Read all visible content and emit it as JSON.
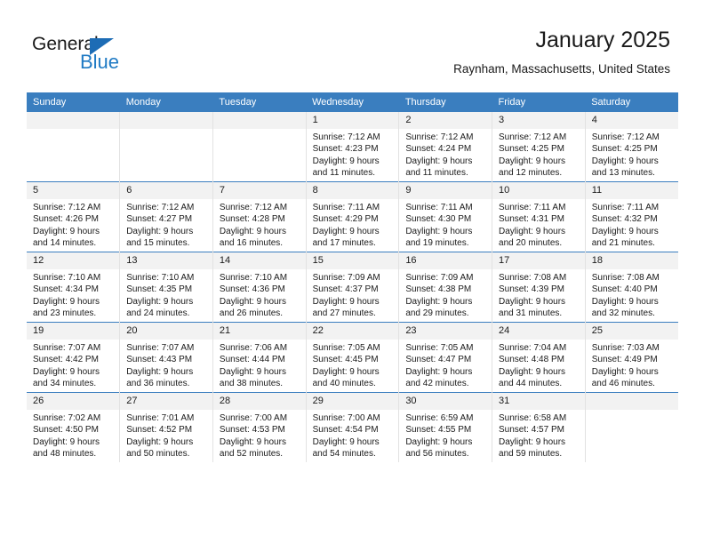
{
  "brand": {
    "name_part1": "General",
    "name_part2": "Blue",
    "logo_color": "#1f7ac4"
  },
  "header": {
    "title": "January 2025",
    "subtitle": "Raynham, Massachusetts, United States"
  },
  "calendar": {
    "header_bg": "#3a7ebf",
    "daynum_bg": "#f2f2f2",
    "weekday_headers": [
      "Sunday",
      "Monday",
      "Tuesday",
      "Wednesday",
      "Thursday",
      "Friday",
      "Saturday"
    ],
    "labels": {
      "sunrise_prefix": "Sunrise:",
      "sunset_prefix": "Sunset:",
      "daylight_prefix": "Daylight:"
    },
    "weeks": [
      [
        {
          "day": "",
          "empty": true
        },
        {
          "day": "",
          "empty": true
        },
        {
          "day": "",
          "empty": true
        },
        {
          "day": "1",
          "sunrise": "Sunrise: 7:12 AM",
          "sunset": "Sunset: 4:23 PM",
          "daylight_line1": "Daylight: 9 hours",
          "daylight_line2": "and 11 minutes."
        },
        {
          "day": "2",
          "sunrise": "Sunrise: 7:12 AM",
          "sunset": "Sunset: 4:24 PM",
          "daylight_line1": "Daylight: 9 hours",
          "daylight_line2": "and 11 minutes."
        },
        {
          "day": "3",
          "sunrise": "Sunrise: 7:12 AM",
          "sunset": "Sunset: 4:25 PM",
          "daylight_line1": "Daylight: 9 hours",
          "daylight_line2": "and 12 minutes."
        },
        {
          "day": "4",
          "sunrise": "Sunrise: 7:12 AM",
          "sunset": "Sunset: 4:25 PM",
          "daylight_line1": "Daylight: 9 hours",
          "daylight_line2": "and 13 minutes."
        }
      ],
      [
        {
          "day": "5",
          "sunrise": "Sunrise: 7:12 AM",
          "sunset": "Sunset: 4:26 PM",
          "daylight_line1": "Daylight: 9 hours",
          "daylight_line2": "and 14 minutes."
        },
        {
          "day": "6",
          "sunrise": "Sunrise: 7:12 AM",
          "sunset": "Sunset: 4:27 PM",
          "daylight_line1": "Daylight: 9 hours",
          "daylight_line2": "and 15 minutes."
        },
        {
          "day": "7",
          "sunrise": "Sunrise: 7:12 AM",
          "sunset": "Sunset: 4:28 PM",
          "daylight_line1": "Daylight: 9 hours",
          "daylight_line2": "and 16 minutes."
        },
        {
          "day": "8",
          "sunrise": "Sunrise: 7:11 AM",
          "sunset": "Sunset: 4:29 PM",
          "daylight_line1": "Daylight: 9 hours",
          "daylight_line2": "and 17 minutes."
        },
        {
          "day": "9",
          "sunrise": "Sunrise: 7:11 AM",
          "sunset": "Sunset: 4:30 PM",
          "daylight_line1": "Daylight: 9 hours",
          "daylight_line2": "and 19 minutes."
        },
        {
          "day": "10",
          "sunrise": "Sunrise: 7:11 AM",
          "sunset": "Sunset: 4:31 PM",
          "daylight_line1": "Daylight: 9 hours",
          "daylight_line2": "and 20 minutes."
        },
        {
          "day": "11",
          "sunrise": "Sunrise: 7:11 AM",
          "sunset": "Sunset: 4:32 PM",
          "daylight_line1": "Daylight: 9 hours",
          "daylight_line2": "and 21 minutes."
        }
      ],
      [
        {
          "day": "12",
          "sunrise": "Sunrise: 7:10 AM",
          "sunset": "Sunset: 4:34 PM",
          "daylight_line1": "Daylight: 9 hours",
          "daylight_line2": "and 23 minutes."
        },
        {
          "day": "13",
          "sunrise": "Sunrise: 7:10 AM",
          "sunset": "Sunset: 4:35 PM",
          "daylight_line1": "Daylight: 9 hours",
          "daylight_line2": "and 24 minutes."
        },
        {
          "day": "14",
          "sunrise": "Sunrise: 7:10 AM",
          "sunset": "Sunset: 4:36 PM",
          "daylight_line1": "Daylight: 9 hours",
          "daylight_line2": "and 26 minutes."
        },
        {
          "day": "15",
          "sunrise": "Sunrise: 7:09 AM",
          "sunset": "Sunset: 4:37 PM",
          "daylight_line1": "Daylight: 9 hours",
          "daylight_line2": "and 27 minutes."
        },
        {
          "day": "16",
          "sunrise": "Sunrise: 7:09 AM",
          "sunset": "Sunset: 4:38 PM",
          "daylight_line1": "Daylight: 9 hours",
          "daylight_line2": "and 29 minutes."
        },
        {
          "day": "17",
          "sunrise": "Sunrise: 7:08 AM",
          "sunset": "Sunset: 4:39 PM",
          "daylight_line1": "Daylight: 9 hours",
          "daylight_line2": "and 31 minutes."
        },
        {
          "day": "18",
          "sunrise": "Sunrise: 7:08 AM",
          "sunset": "Sunset: 4:40 PM",
          "daylight_line1": "Daylight: 9 hours",
          "daylight_line2": "and 32 minutes."
        }
      ],
      [
        {
          "day": "19",
          "sunrise": "Sunrise: 7:07 AM",
          "sunset": "Sunset: 4:42 PM",
          "daylight_line1": "Daylight: 9 hours",
          "daylight_line2": "and 34 minutes."
        },
        {
          "day": "20",
          "sunrise": "Sunrise: 7:07 AM",
          "sunset": "Sunset: 4:43 PM",
          "daylight_line1": "Daylight: 9 hours",
          "daylight_line2": "and 36 minutes."
        },
        {
          "day": "21",
          "sunrise": "Sunrise: 7:06 AM",
          "sunset": "Sunset: 4:44 PM",
          "daylight_line1": "Daylight: 9 hours",
          "daylight_line2": "and 38 minutes."
        },
        {
          "day": "22",
          "sunrise": "Sunrise: 7:05 AM",
          "sunset": "Sunset: 4:45 PM",
          "daylight_line1": "Daylight: 9 hours",
          "daylight_line2": "and 40 minutes."
        },
        {
          "day": "23",
          "sunrise": "Sunrise: 7:05 AM",
          "sunset": "Sunset: 4:47 PM",
          "daylight_line1": "Daylight: 9 hours",
          "daylight_line2": "and 42 minutes."
        },
        {
          "day": "24",
          "sunrise": "Sunrise: 7:04 AM",
          "sunset": "Sunset: 4:48 PM",
          "daylight_line1": "Daylight: 9 hours",
          "daylight_line2": "and 44 minutes."
        },
        {
          "day": "25",
          "sunrise": "Sunrise: 7:03 AM",
          "sunset": "Sunset: 4:49 PM",
          "daylight_line1": "Daylight: 9 hours",
          "daylight_line2": "and 46 minutes."
        }
      ],
      [
        {
          "day": "26",
          "sunrise": "Sunrise: 7:02 AM",
          "sunset": "Sunset: 4:50 PM",
          "daylight_line1": "Daylight: 9 hours",
          "daylight_line2": "and 48 minutes."
        },
        {
          "day": "27",
          "sunrise": "Sunrise: 7:01 AM",
          "sunset": "Sunset: 4:52 PM",
          "daylight_line1": "Daylight: 9 hours",
          "daylight_line2": "and 50 minutes."
        },
        {
          "day": "28",
          "sunrise": "Sunrise: 7:00 AM",
          "sunset": "Sunset: 4:53 PM",
          "daylight_line1": "Daylight: 9 hours",
          "daylight_line2": "and 52 minutes."
        },
        {
          "day": "29",
          "sunrise": "Sunrise: 7:00 AM",
          "sunset": "Sunset: 4:54 PM",
          "daylight_line1": "Daylight: 9 hours",
          "daylight_line2": "and 54 minutes."
        },
        {
          "day": "30",
          "sunrise": "Sunrise: 6:59 AM",
          "sunset": "Sunset: 4:55 PM",
          "daylight_line1": "Daylight: 9 hours",
          "daylight_line2": "and 56 minutes."
        },
        {
          "day": "31",
          "sunrise": "Sunrise: 6:58 AM",
          "sunset": "Sunset: 4:57 PM",
          "daylight_line1": "Daylight: 9 hours",
          "daylight_line2": "and 59 minutes."
        },
        {
          "day": "",
          "empty": true
        }
      ]
    ]
  }
}
